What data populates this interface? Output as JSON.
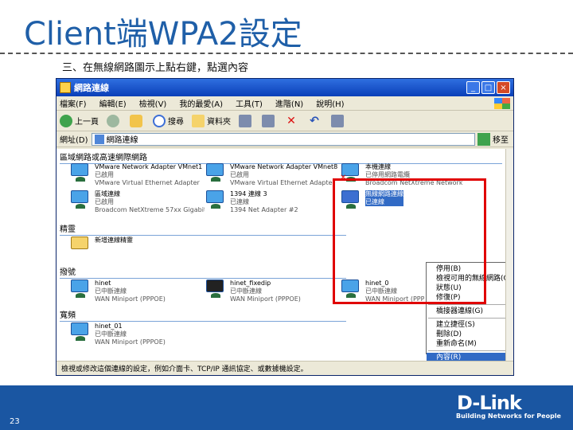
{
  "slide": {
    "title": "Client端WPA2設定",
    "step": "三、在無線網路圖示上點右鍵，點選內容",
    "page_number": "23"
  },
  "window": {
    "title": "網路連線",
    "menu": [
      "檔案(F)",
      "編輯(E)",
      "檢視(V)",
      "我的最愛(A)",
      "工具(T)",
      "進階(N)",
      "說明(H)"
    ],
    "toolbar": {
      "back": "上一頁",
      "search": "搜尋",
      "folders": "資料夾"
    },
    "address_label": "網址(D)",
    "address_value": "網路連線",
    "go_label": "移至",
    "groups": [
      "區域網路或高速網際網路",
      "精靈",
      "撥號",
      "寬頻"
    ],
    "items": [
      {
        "name": "VMware Network Adapter VMnet1",
        "sub1": "已啟用",
        "sub2": "VMware Virtual Ethernet Adapter"
      },
      {
        "name": "VMware Network Adapter VMnet8",
        "sub1": "已啟用",
        "sub2": "VMware Virtual Ethernet Adapter"
      },
      {
        "name": "區域連線",
        "sub1": "已啟用",
        "sub2": "Broadcom NetXtreme 57xx Gigabit"
      },
      {
        "name": "1394 連線 3",
        "sub1": "已連線",
        "sub2": "1394 Net Adapter #2"
      },
      {
        "name": "新增連線精靈",
        "sub1": "",
        "sub2": ""
      },
      {
        "name": "hinet",
        "sub1": "已中斷連線",
        "sub2": "WAN Miniport (PPPOE)"
      },
      {
        "name": "hinet_fixedip",
        "sub1": "已中斷連線",
        "sub2": "WAN Miniport (PPPOE)"
      },
      {
        "name": "hinet_0",
        "sub1": "已中斷連線",
        "sub2": "WAN Miniport (PPPOE)"
      },
      {
        "name": "hinet_01",
        "sub1": "已中斷連線",
        "sub2": "WAN Miniport (PPPOE)"
      }
    ],
    "disabled_item": {
      "name": "本機連線",
      "sub1": "已停用網路電纜",
      "sub2": "Broadcom NetXtreme Network"
    },
    "wireless_item": {
      "name": "無線網路連線",
      "sub1": "已連線"
    },
    "context_menu": [
      "停用(B)",
      "檢視可用的無線網路(O)",
      "狀態(U)",
      "修復(P)",
      "---",
      "橋接器連線(G)",
      "---",
      "建立捷徑(S)",
      "刪除(D)",
      "重新命名(M)",
      "---",
      "內容(R)"
    ],
    "status": "檢視或修改這個連線的設定，例如介面卡、TCP/IP 通訊協定、或數據機設定。"
  },
  "branding": {
    "logo": "D-Link",
    "tagline": "Building Networks for People"
  },
  "colors": {
    "title": "#1f5fa8",
    "footer": "#1a56a2",
    "highlight_box": "#e00000",
    "menu_selected": "#316ac5"
  }
}
